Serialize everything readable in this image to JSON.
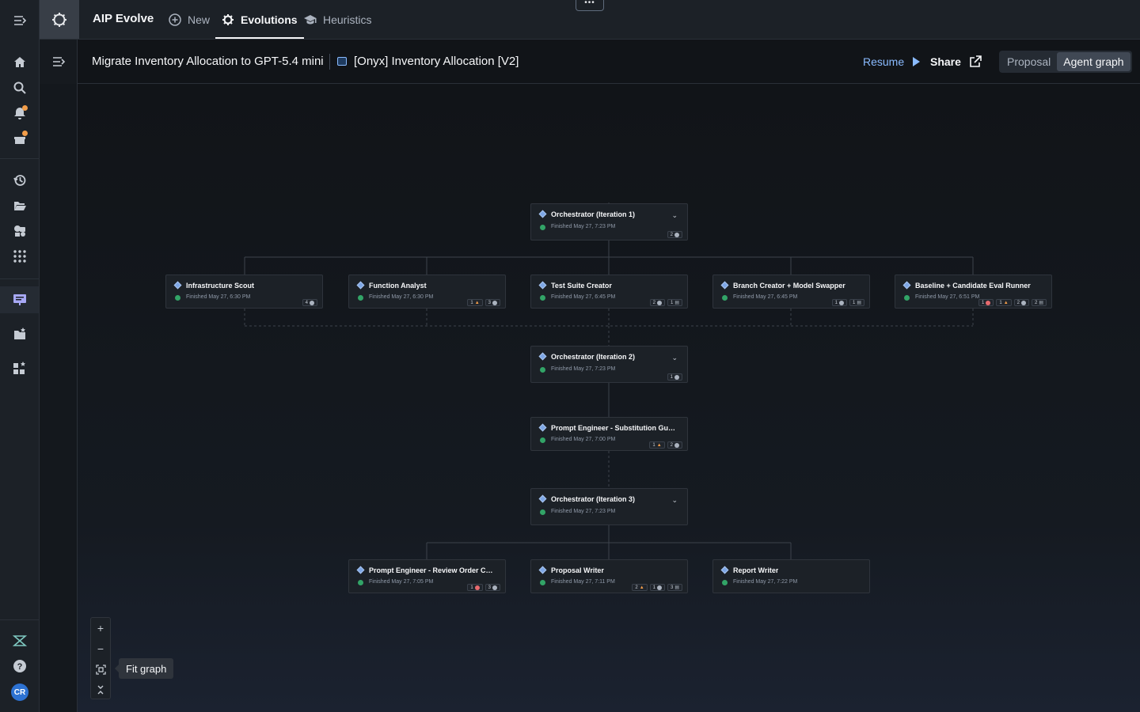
{
  "app": {
    "title": "AIP Evolve"
  },
  "nav": {
    "tabs": [
      {
        "label": "New",
        "icon": "plus-circle-icon"
      },
      {
        "label": "Evolutions",
        "icon": "gear-icon",
        "active": true
      },
      {
        "label": "Heuristics",
        "icon": "graduation-cap-icon"
      }
    ],
    "more": "•••"
  },
  "header": {
    "breadcrumb_title": "Migrate Inventory Allocation to GPT-5.4 mini",
    "breadcrumb_resource": "[Onyx] Inventory Allocation [V2]",
    "resume_label": "Resume",
    "share_label": "Share",
    "view_toggle": [
      "Proposal",
      "Agent graph"
    ],
    "active_view": "Agent graph"
  },
  "graph": {
    "nodes": {
      "orch1": {
        "title": "Orchestrator (Iteration 1)",
        "status": "Finished May 27, 7:23 PM",
        "badges": [
          "2"
        ]
      },
      "scout": {
        "title": "Infrastructure Scout",
        "status": "Finished May 27, 6:30 PM",
        "badges": [
          "4"
        ]
      },
      "analyst": {
        "title": "Function Analyst",
        "status": "Finished May 27, 6:30 PM",
        "badges": [
          "1",
          "3"
        ]
      },
      "suite": {
        "title": "Test Suite Creator",
        "status": "Finished May 27, 6:45 PM",
        "badges": [
          "2",
          "1"
        ]
      },
      "branch": {
        "title": "Branch Creator + Model Swapper",
        "status": "Finished May 27, 6:45 PM",
        "badges": [
          "1",
          "1"
        ]
      },
      "runner": {
        "title": "Baseline + Candidate Eval Runner",
        "status": "Finished May 27, 6:51 PM",
        "badges": [
          "1",
          "1",
          "2",
          "2"
        ]
      },
      "orch2": {
        "title": "Orchestrator (Iteration 2)",
        "status": "Finished May 27, 7:23 PM",
        "badges": [
          "1"
        ]
      },
      "pe_sub": {
        "title": "Prompt Engineer - Substitution Guardr...",
        "status": "Finished May 27, 7:00 PM",
        "badges": [
          "1",
          "2"
        ]
      },
      "orch3": {
        "title": "Orchestrator (Iteration 3)",
        "status": "Finished May 27, 7:23 PM",
        "badges": []
      },
      "pe_rev": {
        "title": "Prompt Engineer - Review Order Com...",
        "status": "Finished May 27, 7:05 PM",
        "badges": [
          "1",
          "3"
        ]
      },
      "proposal": {
        "title": "Proposal Writer",
        "status": "Finished May 27, 7:11 PM",
        "badges": [
          "2",
          "1",
          "3"
        ]
      },
      "report": {
        "title": "Report Writer",
        "status": "Finished May 27, 7:22 PM",
        "badges": []
      }
    }
  },
  "zoom_controls": {
    "zoom_in": "+",
    "zoom_out": "−",
    "fit_tooltip": "Fit graph"
  },
  "user": {
    "initials": "CR"
  },
  "colors": {
    "accent": "#8abbff",
    "success": "#32a467",
    "warning": "#f29d49",
    "danger": "#e76a6e"
  }
}
